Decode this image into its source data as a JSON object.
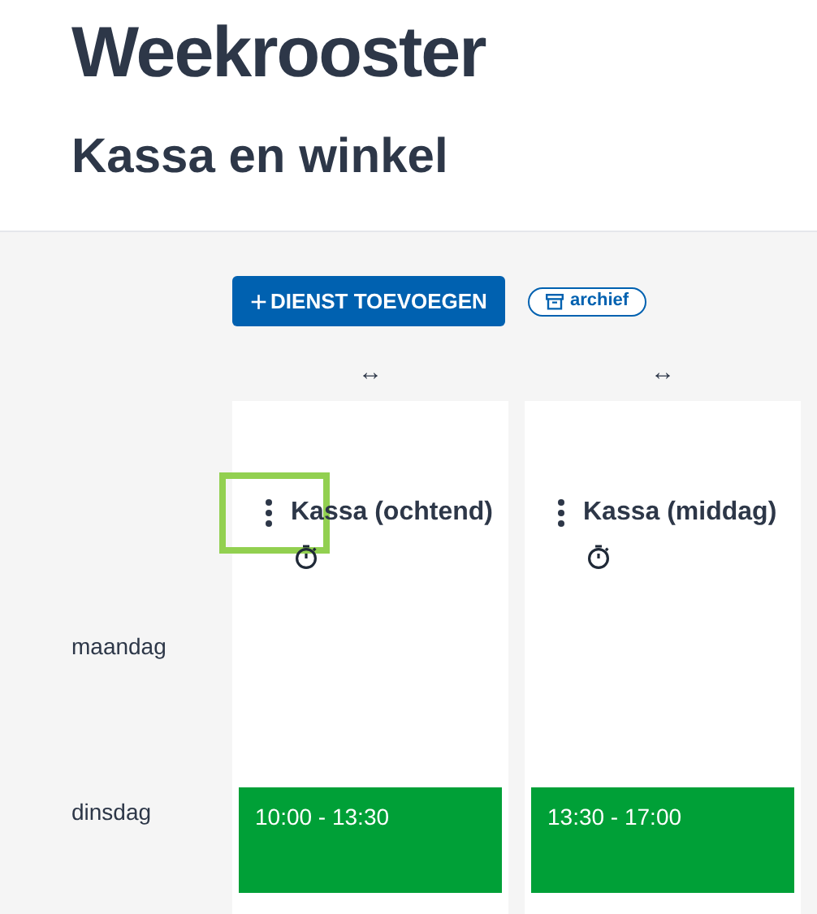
{
  "title": "Weekrooster",
  "subtitle": "Kassa en winkel",
  "add_button": {
    "icon": "+",
    "label": "DIENST TOEVOEGEN"
  },
  "archive_button": {
    "label": "archief"
  },
  "columns": [
    {
      "resize_handle": "↔",
      "title": "Kassa (ochtend)",
      "menu_focused": true
    },
    {
      "resize_handle": "↔",
      "title": "Kassa (middag)",
      "menu_focused": false
    }
  ],
  "days": [
    {
      "label": "maandag"
    },
    {
      "label": "dinsdag",
      "shifts": [
        "10:00 - 13:30",
        "13:30 - 17:00"
      ]
    }
  ]
}
